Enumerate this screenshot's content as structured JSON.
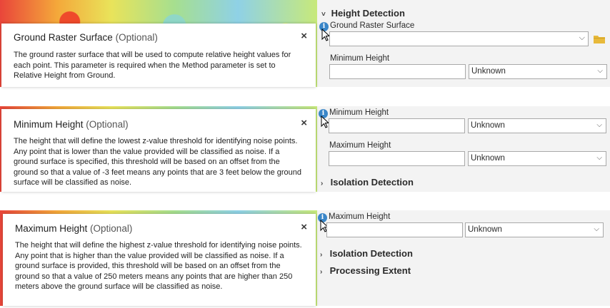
{
  "block1": {
    "tooltip": {
      "title": "Ground Raster Surface",
      "optional": "(Optional)",
      "close": "×",
      "body": "The ground raster surface that will be used to compute relative height values for each point. This parameter is required when the Method parameter is set to Relative Height from Ground."
    },
    "panel": {
      "section": "Height Detection",
      "ground_label": "Ground Raster Surface",
      "ground_value": "",
      "min_label": "Minimum Height",
      "min_value": "",
      "min_unit": "Unknown"
    }
  },
  "block2": {
    "tooltip": {
      "title": "Minimum Height",
      "optional": "(Optional)",
      "close": "×",
      "body": "The height that will define the lowest z-value threshold for identifying noise points. Any point that is lower than the value provided will be classified as noise. If a ground surface is specified, this threshold will be based on an offset from the ground so that a value of -3 feet means any points that are 3 feet below the ground surface will be classified as noise."
    },
    "panel": {
      "min_label": "Minimum Height",
      "min_value": "",
      "min_unit": "Unknown",
      "max_label": "Maximum Height",
      "max_value": "",
      "max_unit": "Unknown",
      "section": "Isolation Detection"
    }
  },
  "block3": {
    "tooltip": {
      "title": "Maximum Height",
      "optional": "(Optional)",
      "close": "×",
      "body": "The height that will define the highest z-value threshold for identifying noise points. Any point that is higher than the value provided will be classified as noise. If a ground surface is provided, this threshold will be based on an offset from the ground so that a value of 250 meters means any points that are higher than 250 meters above the ground surface will be classified as noise."
    },
    "panel": {
      "max_label": "Maximum Height",
      "max_value": "",
      "max_unit": "Unknown",
      "section1": "Isolation Detection",
      "section2": "Processing Extent"
    }
  },
  "icons": {
    "info": "i",
    "expanded_chevron": "˅",
    "collapsed_chevron": "›",
    "dropdown": "⌵"
  },
  "colors": {
    "panel_bg": "#f3f3f3",
    "info_blue": "#3a86c8",
    "folder_yellow": "#e8b93a"
  }
}
